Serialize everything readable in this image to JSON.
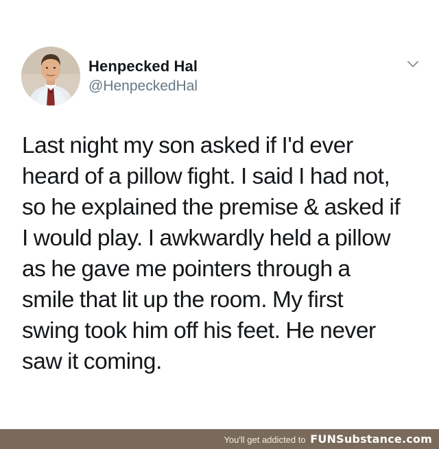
{
  "tweet": {
    "display_name": "Henpecked Hal",
    "handle": "@HenpeckedHal",
    "menu_icon": "chevron-down-icon",
    "avatar_icon": "profile-photo",
    "text_lines": [
      "Last night my son asked if I'd ever",
      "heard of a pillow fight. I said I had not,",
      "so he explained the premise & asked if",
      "I would play. I awkwardly held a pillow",
      "as he gave me pointers through a",
      "smile that lit up the room. My first",
      "swing took him off his feet. He never",
      "saw it coming."
    ]
  },
  "footer": {
    "tagline": "You'll get addicted to",
    "brand": "FUNSubstance.com",
    "background_color": "#7a6a5c"
  },
  "colors": {
    "primary_text": "#14171a",
    "secondary_text": "#657786",
    "chevron": "#8899a6"
  }
}
